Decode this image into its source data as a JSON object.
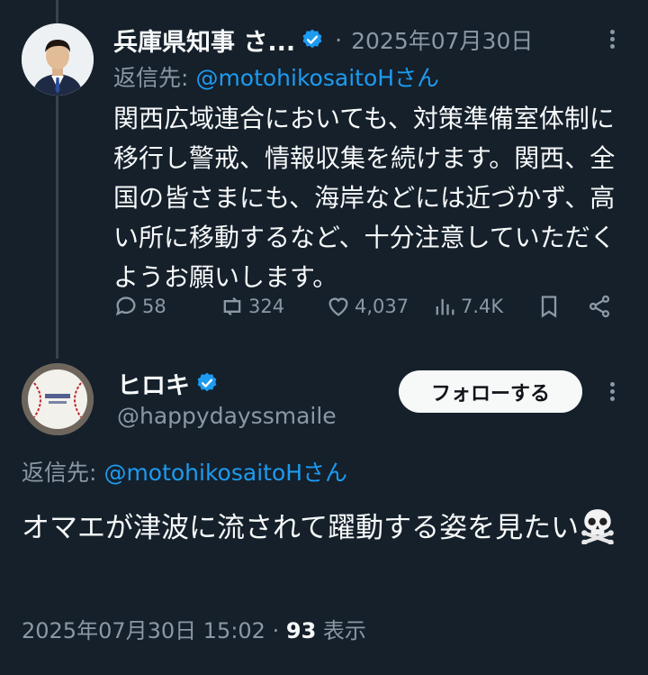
{
  "tweet1": {
    "author_name": "兵庫県知事 さ...",
    "separator": "·",
    "date": "2025年07月30日",
    "reply_prefix": "返信先:",
    "reply_handle": "@motohikosaitoHさん",
    "body": "関西広域連合においても、対策準備室体制に移行し警戒、情報収集を続けます。関西、全国の皆さまにも、海岸などには近づかず、高い所に移動するなど、十分注意していただくようお願いします。",
    "stats": {
      "replies": "58",
      "reposts": "324",
      "likes": "4,037",
      "views": "7.4K"
    }
  },
  "tweet2": {
    "author_name": "ヒロキ",
    "handle": "@happydayssmaile",
    "follow_label": "フォローする",
    "reply_prefix": "返信先:",
    "reply_handle": "@motohikosaitoHさん",
    "body": "オマエが津波に流されて躍動する姿を見たい",
    "emoji": "skull-and-crossbones-icon",
    "timestamp": "2025年07月30日 15:02",
    "sep": "·",
    "views_count": "93",
    "views_label": "表示"
  },
  "colors": {
    "background": "#15202b",
    "accent": "#1d9bf0",
    "muted": "#8b98a5",
    "text": "#f7f9f9"
  }
}
